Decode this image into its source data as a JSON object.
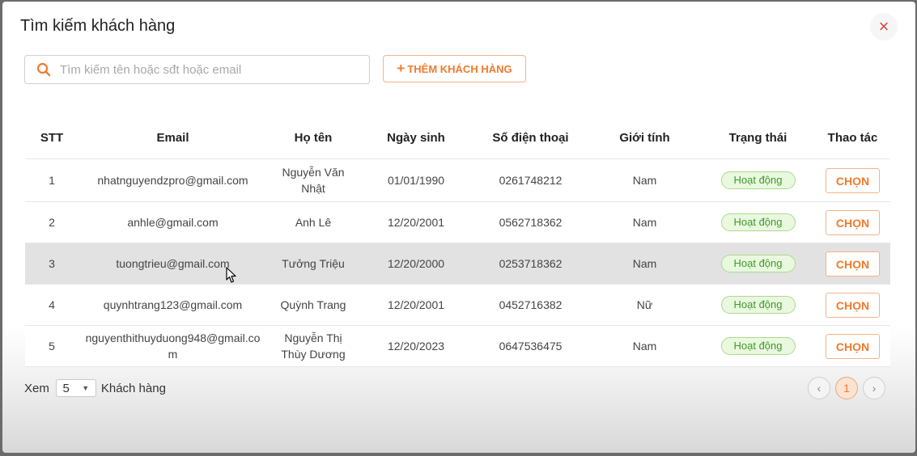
{
  "dialog": {
    "title": "Tìm kiếm khách hàng",
    "close_icon": "×",
    "search_placeholder": "Tìm kiếm tên hoặc sđt hoặc email",
    "search_value": "",
    "add_button_plus": "+",
    "add_button_label": "THÊM KHÁCH HÀNG"
  },
  "table": {
    "headers": [
      "STT",
      "Email",
      "Họ tên",
      "Ngày sinh",
      "Số điện thoại",
      "Giới tính",
      "Trạng thái",
      "Thao tác"
    ],
    "rows": [
      {
        "stt": "1",
        "email": "nhatnguyendzpro@gmail.com",
        "name": "Nguyễn Văn Nhật",
        "dob": "01/01/1990",
        "phone": "0261748212",
        "gender": "Nam",
        "status": "Hoạt động",
        "action": "CHỌN"
      },
      {
        "stt": "2",
        "email": "anhle@gmail.com",
        "name": "Anh Lê",
        "dob": "12/20/2001",
        "phone": "0562718362",
        "gender": "Nam",
        "status": "Hoạt động",
        "action": "CHỌN"
      },
      {
        "stt": "3",
        "email": "tuongtrieu@gmail.com",
        "name": "Tưởng Triệu",
        "dob": "12/20/2000",
        "phone": "0253718362",
        "gender": "Nam",
        "status": "Hoạt động",
        "action": "CHỌN"
      },
      {
        "stt": "4",
        "email": "quynhtrang123@gmail.com",
        "name": "Quỳnh Trang",
        "dob": "12/20/2001",
        "phone": "0452716382",
        "gender": "Nữ",
        "status": "Hoạt động",
        "action": "CHỌN"
      },
      {
        "stt": "5",
        "email": "nguyenthithuyduong948@gmail.com",
        "name": "Nguyễn Thị Thùy Dương",
        "dob": "12/20/2023",
        "phone": "0647536475",
        "gender": "Nam",
        "status": "Hoạt động",
        "action": "CHỌN"
      }
    ]
  },
  "footer": {
    "show_label": "Xem",
    "page_size": "5",
    "unit_label": "Khách hàng",
    "current_page": "1",
    "prev_icon": "‹",
    "next_icon": "›"
  },
  "colors": {
    "accent": "#f07a2b",
    "status_text": "#3e9b2a",
    "status_bg": "#eaf8df",
    "close": "#e0453a",
    "hover_row": "#e2e2e2"
  },
  "icons": {
    "close": "close-icon",
    "search": "search-icon",
    "caret": "chevron-down-icon",
    "prev": "chevron-left-icon",
    "next": "chevron-right-icon",
    "cursor": "mouse-pointer-icon"
  }
}
